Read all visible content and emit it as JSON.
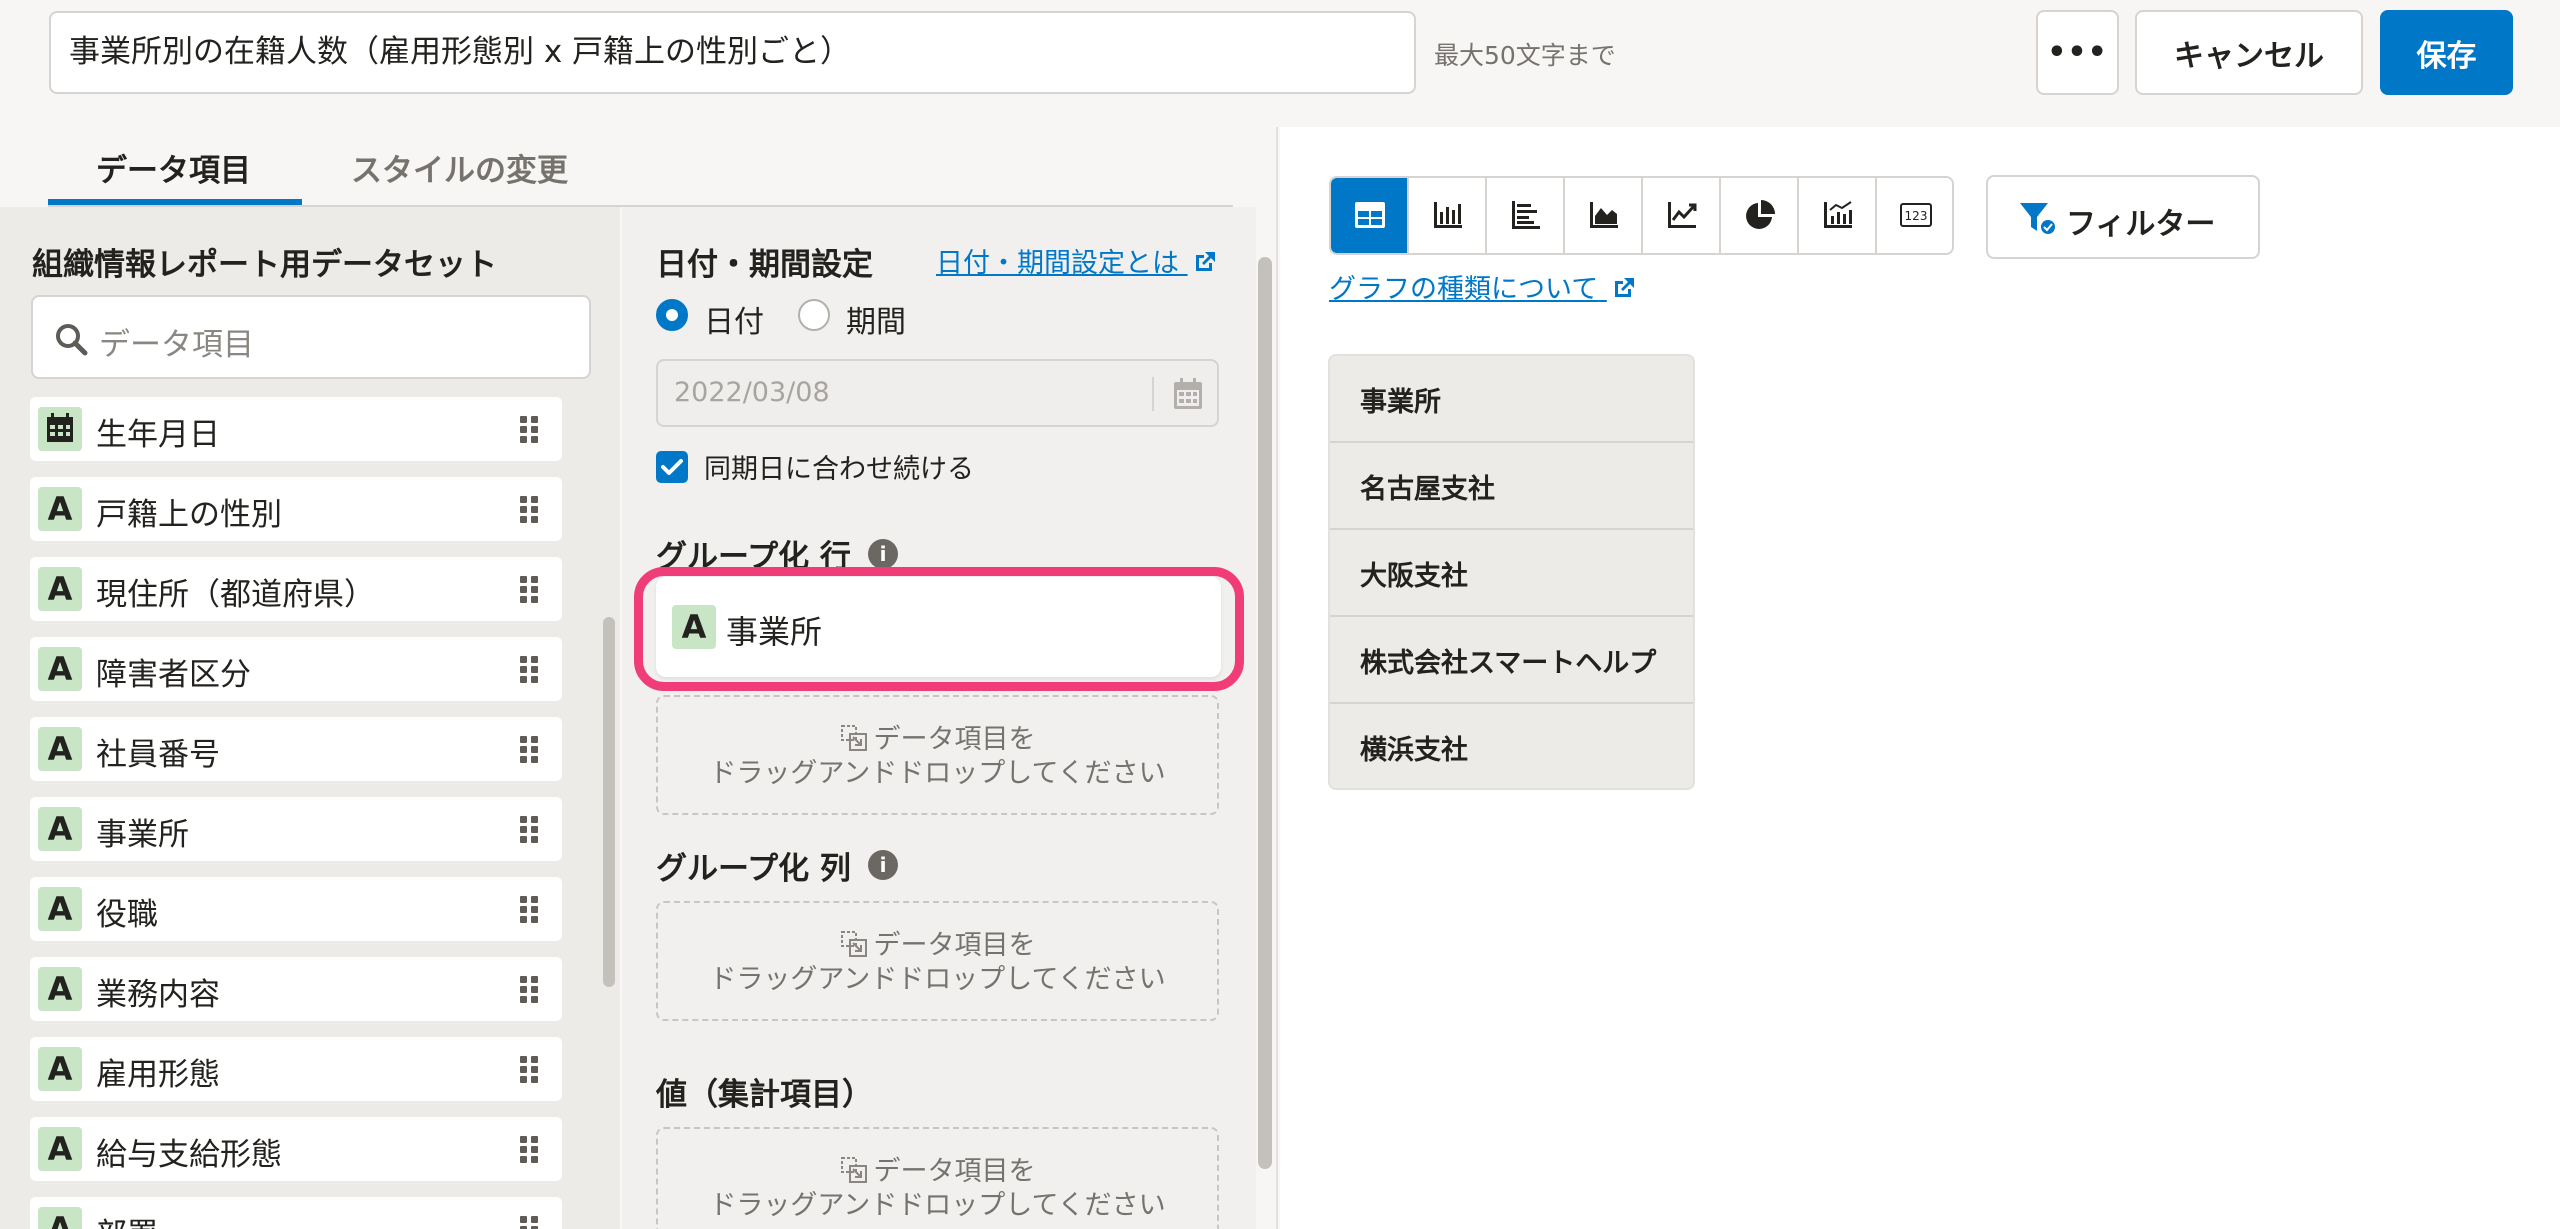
{
  "header": {
    "report_title": "事業所別の在籍人数（雇用形態別 x 戸籍上の性別ごと）",
    "title_hint": "最大50文字まで",
    "more_label": "•••",
    "cancel_label": "キャンセル",
    "save_label": "保存"
  },
  "tabs": [
    {
      "label": "データ項目",
      "active": true
    },
    {
      "label": "スタイルの変更",
      "active": false
    }
  ],
  "dataset": {
    "title": "組織情報レポート用データセット",
    "search_placeholder": "データ項目",
    "items": [
      {
        "type": "date-icon",
        "label": "生年月日"
      },
      {
        "type": "A",
        "label": "戸籍上の性別"
      },
      {
        "type": "A",
        "label": "現住所（都道府県）"
      },
      {
        "type": "A",
        "label": "障害者区分"
      },
      {
        "type": "A",
        "label": "社員番号"
      },
      {
        "type": "A",
        "label": "事業所"
      },
      {
        "type": "A",
        "label": "役職"
      },
      {
        "type": "A",
        "label": "業務内容"
      },
      {
        "type": "A",
        "label": "雇用形態"
      },
      {
        "type": "A",
        "label": "給与支給形態"
      },
      {
        "type": "A",
        "label": "部署"
      }
    ]
  },
  "settings": {
    "date_section_title": "日付・期間設定",
    "date_help_link": "日付・期間設定とは",
    "radio_date": "日付",
    "radio_period": "期間",
    "date_value": "2022/03/08",
    "sync_checkbox_label": "同期日に合わせ続ける",
    "group_row_title": "グループ化 行",
    "group_row_chip": {
      "badge": "A",
      "label": "事業所"
    },
    "group_col_title": "グループ化 列",
    "values_title": "値（集計項目）",
    "dropzone_line1": "データ項目を",
    "dropzone_line2": "ドラッグアンドドロップしてください",
    "info_glyph": "i"
  },
  "preview": {
    "filter_label": "フィルター",
    "chart_help_link": "グラフの種類について",
    "chart_types": [
      "table-icon",
      "bar-chart-icon",
      "horizontal-bar-icon",
      "area-chart-icon",
      "line-chart-icon",
      "pie-chart-icon",
      "combo-chart-icon",
      "number-icon"
    ],
    "number_icon_text": "123",
    "table_header": "事業所",
    "table_rows": [
      "名古屋支社",
      "大阪支社",
      "株式会社スマートヘルプ",
      "横浜支社"
    ]
  },
  "colors": {
    "accent": "#0077c7",
    "highlight": "#f03c78",
    "badge_bg": "#c8e6c5"
  }
}
